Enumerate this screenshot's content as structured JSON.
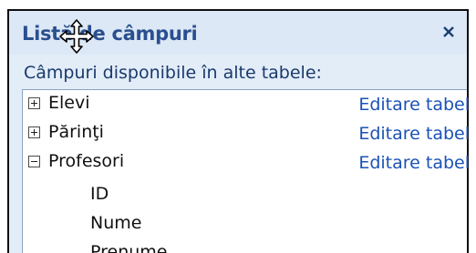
{
  "panel": {
    "title": "Listă de câmpuri",
    "close_icon": "close-icon",
    "subtitle": "Câmpuri disponibile în alte tabele:",
    "cursor_icon": "move-cursor-icon"
  },
  "tables": [
    {
      "name": "Elevi",
      "expanded": false,
      "action_label": "Editare tabel"
    },
    {
      "name": "Părinţi",
      "expanded": false,
      "action_label": "Editare tabel"
    },
    {
      "name": "Profesori",
      "expanded": true,
      "action_label": "Editare tabel",
      "fields": [
        "ID",
        "Nume",
        "Prenume"
      ]
    }
  ],
  "colors": {
    "title": "#2a4f8f",
    "link": "#1a52b8",
    "panel_bg": "#e3edf8"
  }
}
